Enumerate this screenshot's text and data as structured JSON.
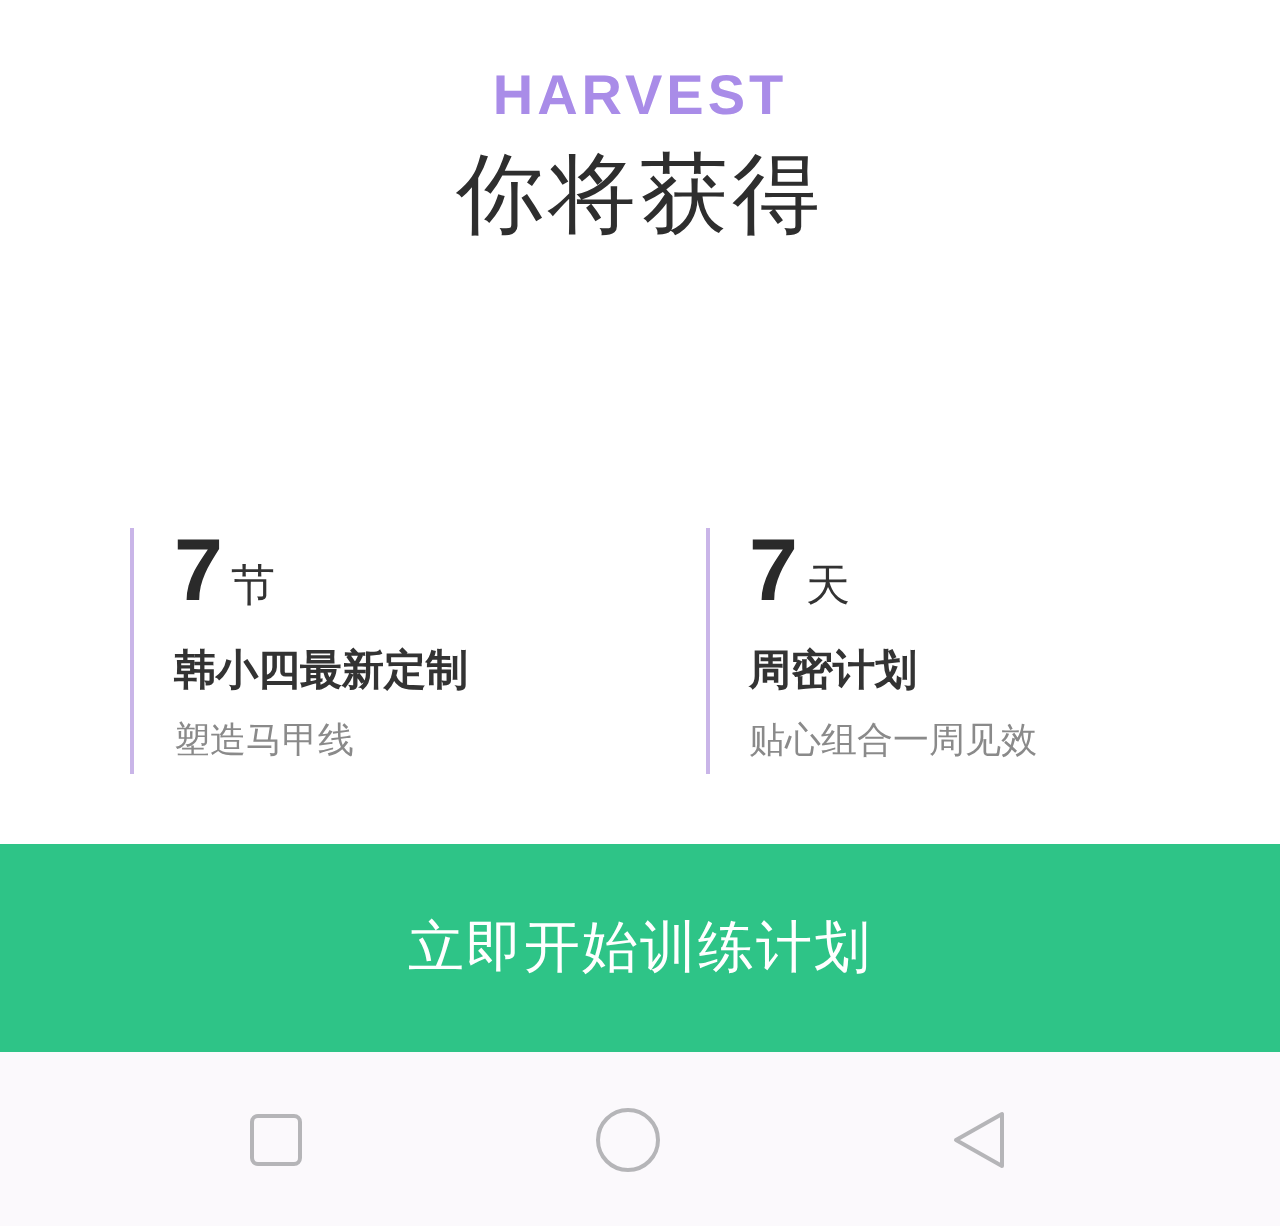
{
  "brand": "HARVEST",
  "title": "你将获得",
  "benefits": [
    {
      "number": "7",
      "unit": "节",
      "heading": "韩小四最新定制",
      "subtitle": "塑造马甲线"
    },
    {
      "number": "7",
      "unit": "天",
      "heading": "周密计划",
      "subtitle": "贴心组合一周见效"
    }
  ],
  "action_button": "立即开始训练计划"
}
